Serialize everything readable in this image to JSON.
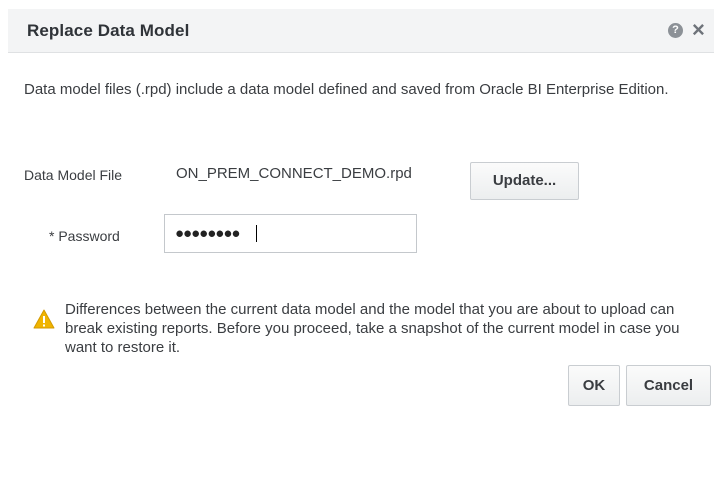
{
  "dialog": {
    "title": "Replace Data Model",
    "help_icon_glyph": "?",
    "close_icon_glyph": "×",
    "description": "Data model files (.rpd) include a data model defined and saved from Oracle BI Enterprise Edition."
  },
  "file_field": {
    "label": "Data Model File",
    "value": "ON_PREM_CONNECT_DEMO.rpd",
    "update_label": "Update..."
  },
  "password_field": {
    "required_marker": "*",
    "label": "Password",
    "masked_value": "●●●●●●●●"
  },
  "warning": {
    "icon": "warning-icon",
    "color": "#f0b400",
    "text": "Differences between the current data model and the model that you are about to upload can break existing reports. Before you proceed, take a snapshot of the current model in case you want to restore it."
  },
  "buttons": {
    "ok_label": "OK",
    "cancel_label": "Cancel"
  }
}
